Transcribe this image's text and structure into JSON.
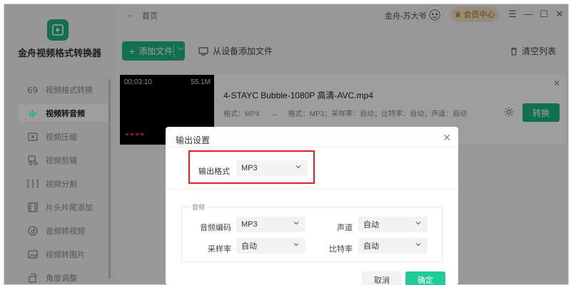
{
  "app": {
    "name": "金舟视频格式转换器"
  },
  "topbar": {
    "breadcrumb": "首页",
    "username": "金舟-苏大爷",
    "vip_label": "会员中心",
    "window_controls": {
      "menu": "☰",
      "minimize": "—",
      "maximize": "☐",
      "close": "✕"
    }
  },
  "sidebar": {
    "items": [
      {
        "label": "视频格式转换",
        "icon": "video-format-icon"
      },
      {
        "label": "视频转音频",
        "icon": "audio-wave-icon",
        "active": true
      },
      {
        "label": "视频压缩",
        "icon": "compress-icon"
      },
      {
        "label": "视频剪辑",
        "icon": "scissors-icon"
      },
      {
        "label": "视频分割",
        "icon": "split-icon"
      },
      {
        "label": "片头片尾添加",
        "icon": "film-icon"
      },
      {
        "label": "音频转视频",
        "icon": "music-disc-icon"
      },
      {
        "label": "视频转图片",
        "icon": "image-icon"
      },
      {
        "label": "角度调整",
        "icon": "rotate-icon"
      }
    ]
  },
  "toolbar": {
    "add_file": "添加文件",
    "from_device": "从设备添加文件",
    "clear_list": "清空列表"
  },
  "file": {
    "duration": "00:03:10",
    "size": "55.1M",
    "name": "4-STAYC Bubble-1080P 高清-AVC.mp4",
    "source_format": "格式：MP4",
    "arrow": "→",
    "target_format": "格式：MP3；采样率：自动；比特率：自动；声道：自动",
    "convert_label": "转换"
  },
  "dialog": {
    "title": "输出设置",
    "output_format_label": "输出格式",
    "output_format_value": "MP3",
    "audio_section": "音频",
    "fields": {
      "codec_label": "音频编码",
      "codec_value": "MP3",
      "channel_label": "声道",
      "channel_value": "自动",
      "sample_rate_label": "采样率",
      "sample_rate_value": "自动",
      "bitrate_label": "比特率",
      "bitrate_value": "自动"
    },
    "cancel": "取消",
    "ok": "确定"
  },
  "colors": {
    "accent": "#1fb384",
    "confirm": "#1fcc99",
    "highlight": "#e02020",
    "vip_bg": "#f4e3c6"
  }
}
